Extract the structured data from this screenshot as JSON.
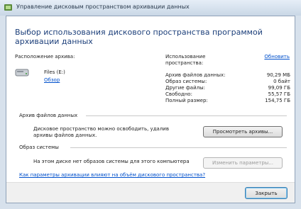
{
  "window": {
    "title": "Управление дисковым пространством архивации данных"
  },
  "heading": "Выбор использования дискового пространства программой архивации данных",
  "location": {
    "label": "Расположение архива:",
    "drive_name": "Files (E:)",
    "browse_link": "Обзор"
  },
  "usage": {
    "label": "Использование пространства:",
    "refresh_link": "Обновить",
    "rows": [
      {
        "label": "Архив файлов данных:",
        "value": "90,29 МБ"
      },
      {
        "label": "Образ системы:",
        "value": "0 байт"
      },
      {
        "label": "Другие файлы:",
        "value": "99,09 ГБ"
      },
      {
        "label": "Свободно:",
        "value": "55,57 ГБ"
      },
      {
        "label": "Полный размер:",
        "value": "154,75 ГБ"
      }
    ]
  },
  "data_archive": {
    "section_title": "Архив файлов данных",
    "description": "Дисковое пространство можно освободить, удалив архивы файлов данных.",
    "button": "Просмотреть архивы..."
  },
  "system_image": {
    "section_title": "Образ системы",
    "description": "На этом диске нет образов системы для этого компьютера",
    "button": "Изменить параметры..."
  },
  "help_link": "Как параметры архивации влияют на объём дискового пространства?",
  "footer": {
    "close_button": "Закрыть"
  },
  "colors": {
    "heading": "#1c3f7a",
    "link": "#0050cc",
    "titlebar": "#c9d7e6"
  }
}
